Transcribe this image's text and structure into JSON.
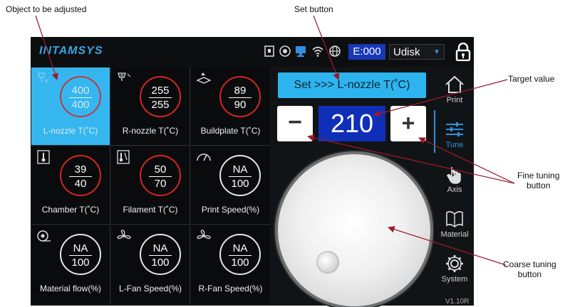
{
  "callouts": {
    "object": "Object to be adjusted",
    "set": "Set button",
    "target": "Target value",
    "fine": "Fine tuning\nbutton",
    "coarse": "Coarse tuning\nbutton"
  },
  "topbar": {
    "logo": "INTAMSYS",
    "e_counter": "E:000",
    "storage": "Udisk",
    "status_icons": [
      "sd-card-icon",
      "camera-icon",
      "monitor-icon",
      "wifi-icon",
      "globe-icon"
    ]
  },
  "cells": [
    {
      "icon": "nozzle-icon",
      "current": "400",
      "target": "400",
      "label": "L-nozzle T(˚C)",
      "active": true
    },
    {
      "icon": "nozzle-icon",
      "current": "255",
      "target": "255",
      "label": "R-nozzle T(˚C)"
    },
    {
      "icon": "buildplate-icon",
      "current": "89",
      "target": "90",
      "label": "Buildplate T(˚C)"
    },
    {
      "icon": "thermometer-icon",
      "current": "39",
      "target": "40",
      "label": "Chamber T(˚C)"
    },
    {
      "icon": "filament-icon",
      "current": "50",
      "target": "70",
      "label": "Filament T(˚C)"
    },
    {
      "icon": "speed-gauge-icon",
      "current": "NA",
      "target": "100",
      "label": "Print Speed(%)"
    },
    {
      "icon": "spool-icon",
      "current": "NA",
      "target": "100",
      "label": "Material flow(%)"
    },
    {
      "icon": "fan-icon",
      "current": "NA",
      "target": "100",
      "label": "L-Fan Speed(%)"
    },
    {
      "icon": "fan-icon",
      "current": "NA",
      "target": "100",
      "label": "R-Fan Speed(%)"
    }
  ],
  "control": {
    "set_label": "Set >>> L-nozzle T(˚C)",
    "minus": "−",
    "plus": "+",
    "target_value": "210"
  },
  "sidebar": [
    {
      "label": "Print",
      "icon": "home-icon"
    },
    {
      "label": "Tune",
      "icon": "sliders-icon",
      "active": true
    },
    {
      "label": "Axis",
      "icon": "hand-icon"
    },
    {
      "label": "Material",
      "icon": "book-icon"
    },
    {
      "label": "System",
      "icon": "gear-icon"
    }
  ],
  "version": "V1.10R",
  "colors": {
    "accent": "#36b6ef",
    "ring": "#d82424",
    "target_bg": "#102fb8"
  }
}
